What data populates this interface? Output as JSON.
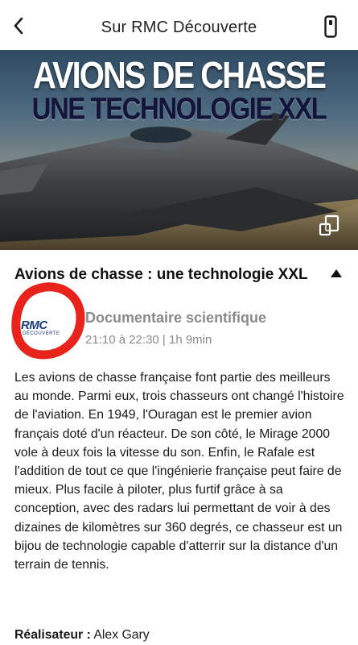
{
  "header": {
    "title": "Sur RMC Découverte",
    "back_icon": "chevron-left-icon",
    "remote_icon": "remote-control-icon"
  },
  "hero": {
    "title_line1": "AVIONS DE CHASSE",
    "title_line2": "UNE TECHNOLOGIE XXL",
    "mosaic_icon": "multi-screen-icon"
  },
  "program": {
    "title": "Avions de chasse : une technologie XXL",
    "collapse_icon": "triangle-up-icon",
    "channel_logo": "RMC",
    "channel_logo_sub": "DÉCOUVERTE",
    "genre": "Documentaire scientifique",
    "schedule": "21:10 à 22:30 | 1h 9min",
    "synopsis": "Les avions de chasse française font partie des meilleurs au monde. Parmi eux, trois chasseurs ont changé l'histoire de l'aviation. En 1949, l'Ouragan est le premier avion français doté d'un réacteur. De son côté, le Mirage 2000 vole à deux fois la vitesse du son. Enfin, le Rafale est l'addition de tout ce que l'ingénierie française peut faire de mieux. Plus facile à piloter, plus furtif grâce à sa conception, avec des radars lui permettant de voir à des dizaines de kilomètres sur 360 degrés, ce chasseur est un bijou de technologie capable d'atterrir sur la distance d'un terrain de tennis.",
    "director_label": "Réalisateur :",
    "director_name": "Alex Gary"
  },
  "colors": {
    "annotation_circle": "#e8231b",
    "logo_blue": "#1b3b7a",
    "muted_text": "#8a8a8a"
  }
}
